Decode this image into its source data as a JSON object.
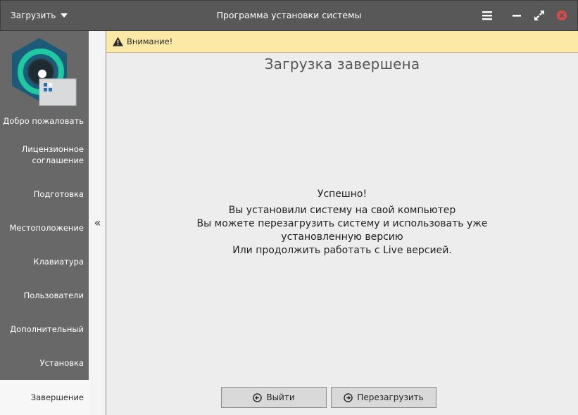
{
  "titlebar": {
    "menu_label": "Загрузить",
    "title": "Программа установки системы"
  },
  "sidebar": {
    "items": [
      {
        "label": "Добро пожаловать"
      },
      {
        "label": "Лицензионное соглашение"
      },
      {
        "label": "Подготовка"
      },
      {
        "label": "Местоположение"
      },
      {
        "label": "Клавиатура"
      },
      {
        "label": "Пользователи"
      },
      {
        "label": "Дополнительный"
      },
      {
        "label": "Установка"
      },
      {
        "label": "Завершение"
      }
    ],
    "active_index": 8,
    "collapse_glyph": "«"
  },
  "warning": {
    "text": "Внимание!"
  },
  "main": {
    "title": "Загрузка завершена",
    "success": "Успешно!",
    "line1": "Вы установили систему на свой компьютер",
    "line2": "Вы можете перезагрузить систему и использовать уже",
    "line3": "установленную версию",
    "line4": "Или продолжить работать с Live версией."
  },
  "buttons": {
    "exit_label": "Выйти",
    "reboot_label": "Перезагрузить"
  },
  "icons": {
    "menu": "hamburger-icon",
    "minimize": "minimize-icon",
    "maximize": "maximize-icon",
    "close": "close-icon",
    "warning": "warning-icon",
    "exit": "exit-icon",
    "reboot": "reboot-icon"
  },
  "colors": {
    "titlebar": "#585858",
    "sidebar": "#686868",
    "warning_bg": "#fce9a6",
    "close": "#e04848",
    "logo_ring": "#1ec8a0"
  }
}
